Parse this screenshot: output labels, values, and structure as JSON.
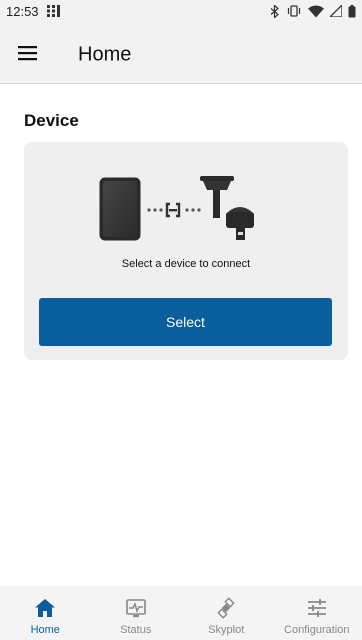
{
  "status_bar": {
    "time": "12:53"
  },
  "app_bar": {
    "title": "Home"
  },
  "device_section": {
    "title": "Device",
    "caption": "Select a device to connect",
    "select_label": "Select"
  },
  "bottom_nav": {
    "active": "Home",
    "items": [
      {
        "label": "Home",
        "icon": "home-icon"
      },
      {
        "label": "Status",
        "icon": "status-monitor-icon"
      },
      {
        "label": "Skyplot",
        "icon": "satellite-icon"
      },
      {
        "label": "Configuration",
        "icon": "sliders-icon"
      }
    ]
  },
  "colors": {
    "primary": "#0a5e9e",
    "card_background": "#efefef",
    "app_bar_background": "#f2f2f2",
    "inactive_nav": "#888888"
  }
}
